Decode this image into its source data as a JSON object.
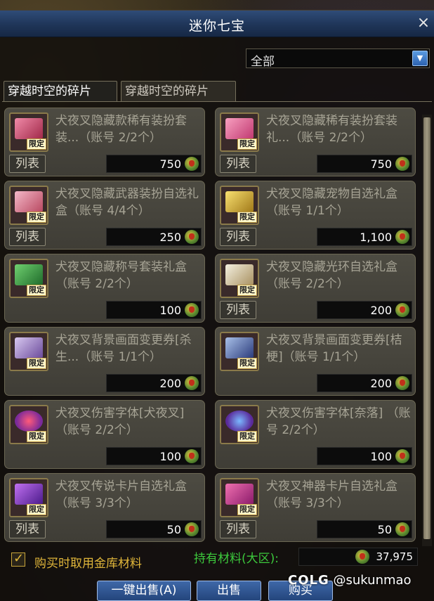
{
  "window": {
    "title": "迷你七宝",
    "close_label": "×"
  },
  "filter": {
    "selected": "全部",
    "arrow": "▼"
  },
  "tabs": [
    {
      "label": "穿越时空的碎片"
    },
    {
      "label": "穿越时空的碎片"
    }
  ],
  "items": [
    {
      "name": "犬夜叉隐藏款稀有装扮套装...（账号 2/2个）",
      "list_label": "列表",
      "tag": "限定",
      "price": "750",
      "icon": "pink-costume-box"
    },
    {
      "name": "犬夜叉隐藏稀有装扮套装礼...（账号 2/2个）",
      "list_label": "列表",
      "tag": "限定",
      "price": "750",
      "icon": "pink-gift-box"
    },
    {
      "name": "犬夜叉隐藏武器装扮自选礼盒（账号 4/4个）",
      "list_label": "列表",
      "tag": "限定",
      "price": "250",
      "icon": "pink-weapon-box"
    },
    {
      "name": "犬夜叉隐藏宠物自选礼盒 （账号 1/1个）",
      "list_label": "列表",
      "tag": "限定",
      "price": "1,100",
      "icon": "gold-pet-box"
    },
    {
      "name": "犬夜叉隐藏称号套装礼盒 （账号 2/2个）",
      "list_label": "",
      "tag": "限定",
      "price": "100",
      "icon": "green-title-box"
    },
    {
      "name": "犬夜叉隐藏光环自选礼盒 （账号 2/2个）",
      "list_label": "列表",
      "tag": "限定",
      "price": "200",
      "icon": "white-aura-box"
    },
    {
      "name": "犬夜叉背景画面变更券[杀生...（账号 1/1个）",
      "list_label": "",
      "tag": "限定",
      "price": "200",
      "icon": "background-ticket"
    },
    {
      "name": "犬夜叉背景画面变更券[桔梗]（账号 1/1个）",
      "list_label": "",
      "tag": "限定",
      "price": "200",
      "icon": "background-ticket-blue"
    },
    {
      "name": "犬夜叉伤害字体[犬夜叉] （账号 2/2个）",
      "list_label": "",
      "tag": "限定",
      "price": "100",
      "icon": "damage-font-red"
    },
    {
      "name": "犬夜叉伤害字体[奈落] （账号 2/2个）",
      "list_label": "",
      "tag": "限定",
      "price": "100",
      "icon": "damage-font-blue"
    },
    {
      "name": "犬夜叉传说卡片自选礼盒 （账号 3/3个）",
      "list_label": "列表",
      "tag": "限定",
      "price": "50",
      "icon": "purple-card-box"
    },
    {
      "name": "犬夜叉神器卡片自选礼盒 （账号 3/3个）",
      "list_label": "列表",
      "tag": "限定",
      "price": "50",
      "icon": "pink-card-box"
    }
  ],
  "footer": {
    "checkbox_label": "购买时取用金库材料",
    "owned_label": "持有材料(大区):",
    "owned_value": "37,975",
    "buttons": {
      "sell_all": "一键出售(A)",
      "sell": "出售",
      "buy": "购买"
    }
  },
  "watermark": {
    "brand": "COLG",
    "handle": "@sukunmao"
  },
  "colors": {
    "title_bar": "#1f3558",
    "card_bg": "#4d4b42",
    "item_text": "#a7a495",
    "checkbox_text": "#e0b63a",
    "owned_text": "#3cc83c",
    "button_blue": "#24457c"
  }
}
